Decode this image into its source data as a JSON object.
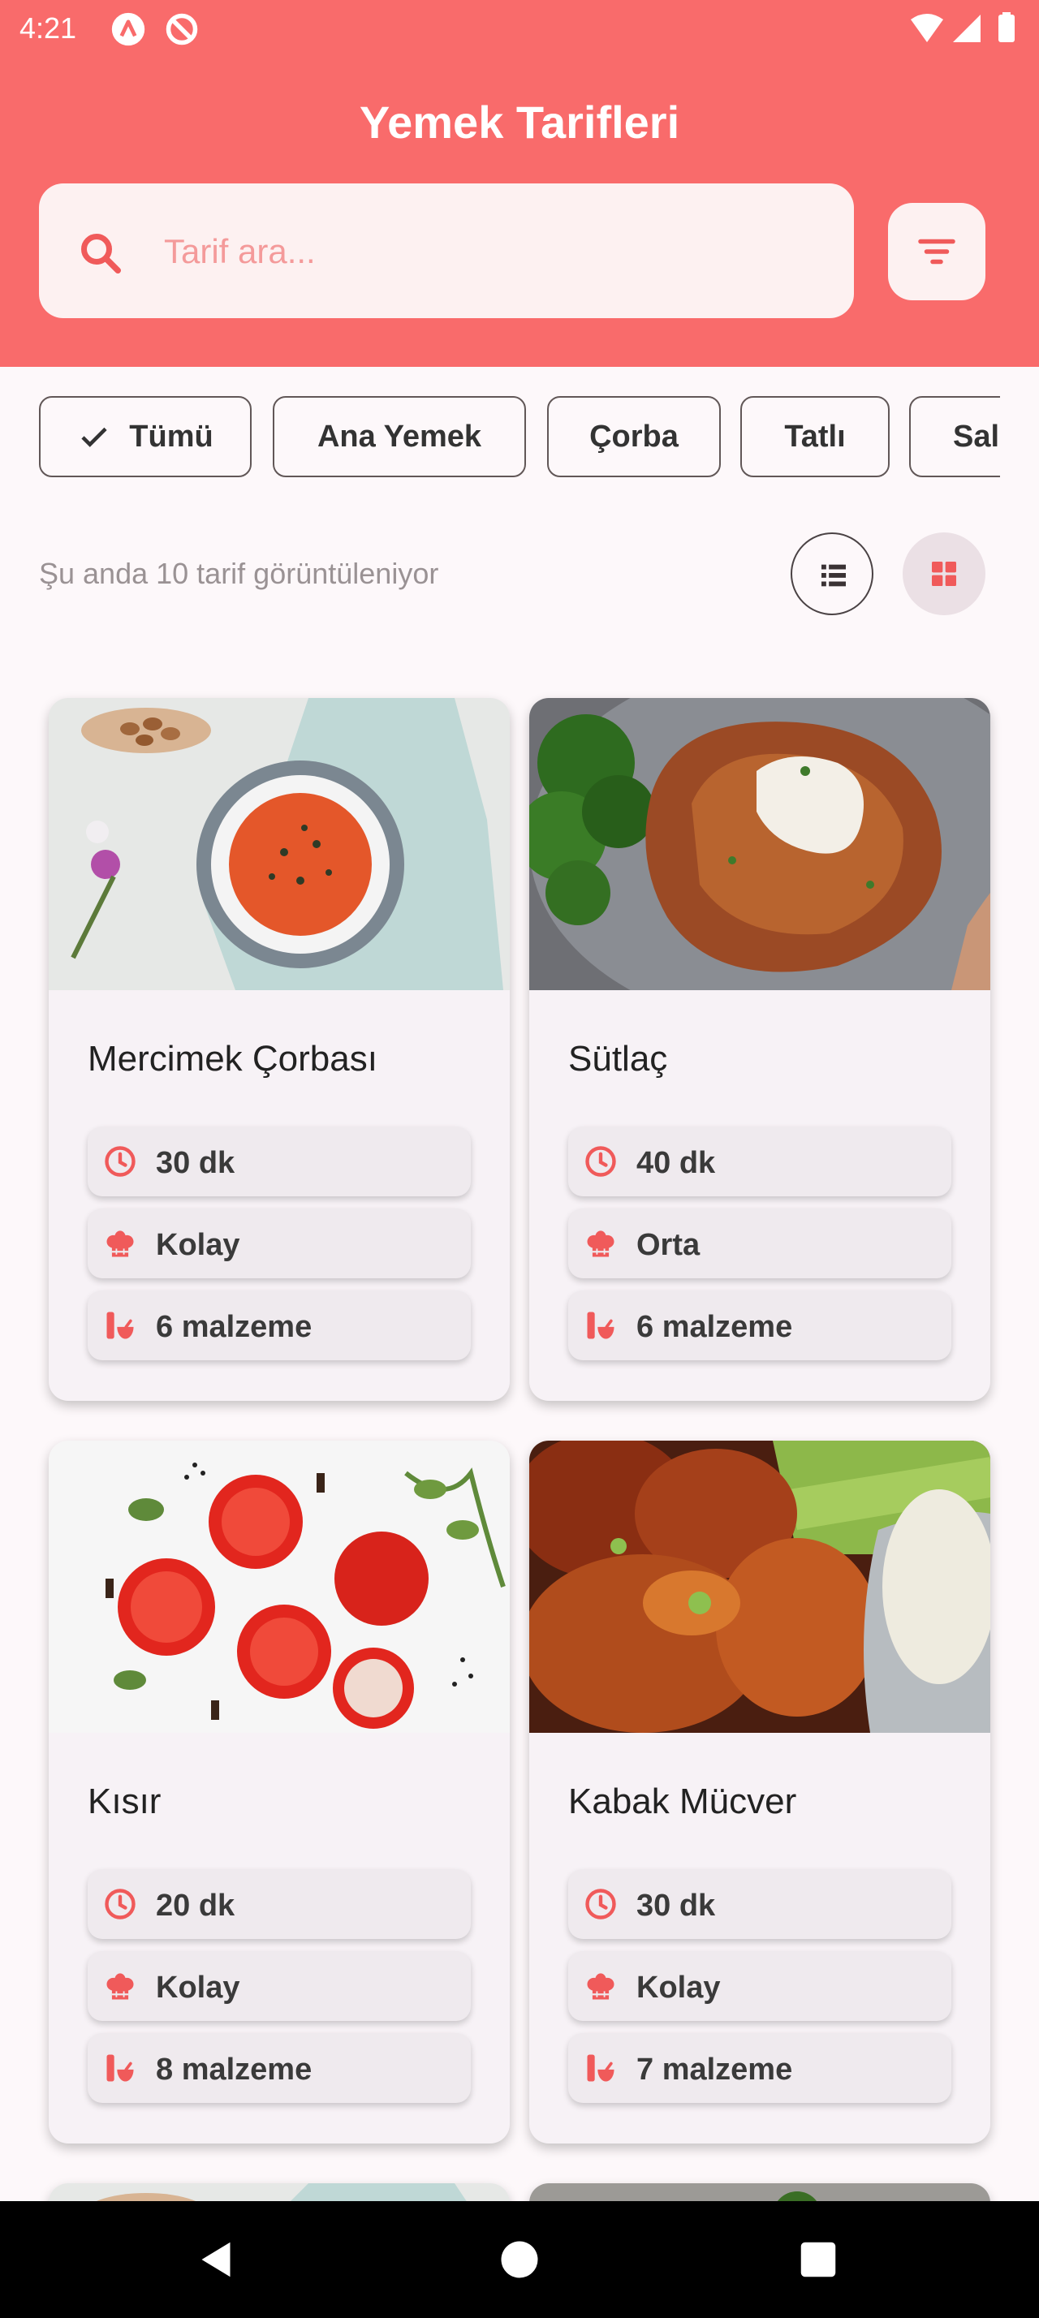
{
  "status": {
    "time": "4:21",
    "icons": [
      "app-a-icon",
      "app-blocked-icon",
      "wifi-icon",
      "signal-icon",
      "battery-icon"
    ]
  },
  "header": {
    "title": "Yemek Tarifleri"
  },
  "search": {
    "placeholder": "Tarif ara...",
    "value": ""
  },
  "categories": [
    {
      "label": "Tümü",
      "selected": true
    },
    {
      "label": "Ana Yemek",
      "selected": false
    },
    {
      "label": "Çorba",
      "selected": false
    },
    {
      "label": "Tatlı",
      "selected": false
    },
    {
      "label": "Salata",
      "selected": false
    }
  ],
  "summary": {
    "count_text": "Şu anda 10 tarif görüntüleniyor",
    "view_mode": "grid"
  },
  "recipes": [
    {
      "title": "Mercimek Çorbası",
      "time": "30 dk",
      "difficulty": "Kolay",
      "ingredients": "6 malzeme",
      "image": "tomato-soup-photo"
    },
    {
      "title": "Sütlaç",
      "time": "40 dk",
      "difficulty": "Orta",
      "ingredients": "6 malzeme",
      "image": "chicken-schnitzel-photo"
    },
    {
      "title": "Kısır",
      "time": "20 dk",
      "difficulty": "Kolay",
      "ingredients": "8 malzeme",
      "image": "tomatoes-spices-photo"
    },
    {
      "title": "Kabak Mücver",
      "time": "30 dk",
      "difficulty": "Kolay",
      "ingredients": "7 malzeme",
      "image": "chicken-wings-photo"
    }
  ],
  "colors": {
    "primary": "#F96B6B",
    "icon_accent": "#F05A5A",
    "background": "#FDF8FA",
    "card": "#F7F2F6",
    "grid_toggle_bg": "#EBE0E5"
  },
  "nav": {
    "items": [
      "back-icon",
      "home-icon",
      "recents-icon"
    ]
  }
}
